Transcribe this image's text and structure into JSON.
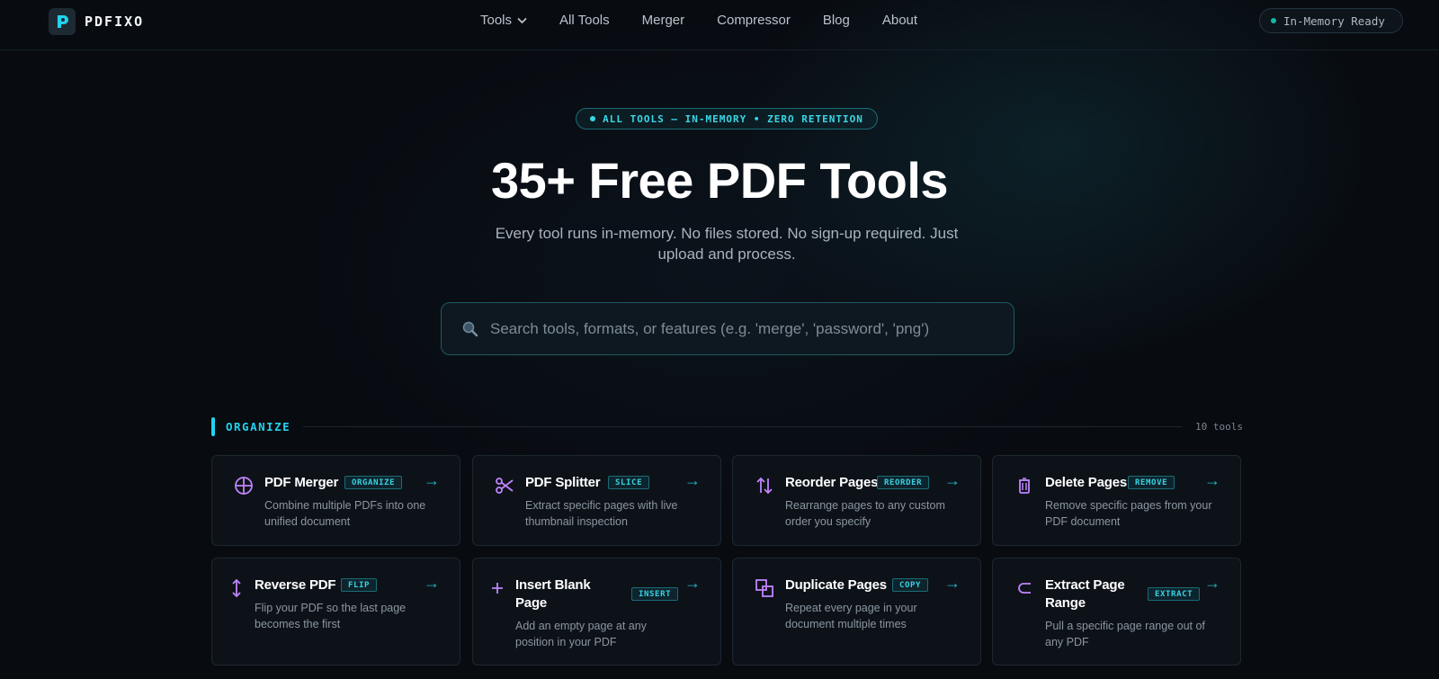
{
  "header": {
    "brand": "PDFIXO",
    "nav": [
      {
        "label": "Tools",
        "has_dropdown": true
      },
      {
        "label": "All Tools"
      },
      {
        "label": "Merger"
      },
      {
        "label": "Compressor"
      },
      {
        "label": "Blog"
      },
      {
        "label": "About"
      }
    ],
    "status": "In-Memory Ready"
  },
  "hero": {
    "badge": "ALL TOOLS — IN-MEMORY • ZERO RETENTION",
    "title": "35+ Free PDF Tools",
    "subtitle": "Every tool runs in-memory. No files stored. No sign-up required. Just upload and process."
  },
  "search": {
    "placeholder": "Search tools, formats, or features (e.g. 'merge', 'password', 'png')",
    "value": ""
  },
  "section": {
    "title": "ORGANIZE",
    "count": "10 tools"
  },
  "cards": [
    {
      "title": "PDF Merger",
      "tag": "ORGANIZE",
      "desc": "Combine multiple PDFs into one unified document",
      "icon": "merge-circle-icon"
    },
    {
      "title": "PDF Splitter",
      "tag": "SLICE",
      "desc": "Extract specific pages with live thumbnail inspection",
      "icon": "scissors-icon"
    },
    {
      "title": "Reorder Pages",
      "tag": "REORDER",
      "desc": "Rearrange pages to any custom order you specify",
      "icon": "reorder-arrows-icon"
    },
    {
      "title": "Delete Pages",
      "tag": "REMOVE",
      "desc": "Remove specific pages from your PDF document",
      "icon": "trash-icon"
    },
    {
      "title": "Reverse PDF",
      "tag": "FLIP",
      "desc": "Flip your PDF so the last page becomes the first",
      "icon": "vertical-arrows-icon"
    },
    {
      "title": "Insert Blank Page",
      "tag": "INSERT",
      "desc": "Add an empty page at any position in your PDF",
      "icon": "plus-icon"
    },
    {
      "title": "Duplicate Pages",
      "tag": "COPY",
      "desc": "Repeat every page in your document multiple times",
      "icon": "duplicate-icon"
    },
    {
      "title": "Extract Page Range",
      "tag": "EXTRACT",
      "desc": "Pull a specific page range out of any PDF",
      "icon": "subset-icon"
    }
  ],
  "colors": {
    "accent": "#22d3ee",
    "icon_purple": "#c084fc",
    "background": "#080b10"
  }
}
